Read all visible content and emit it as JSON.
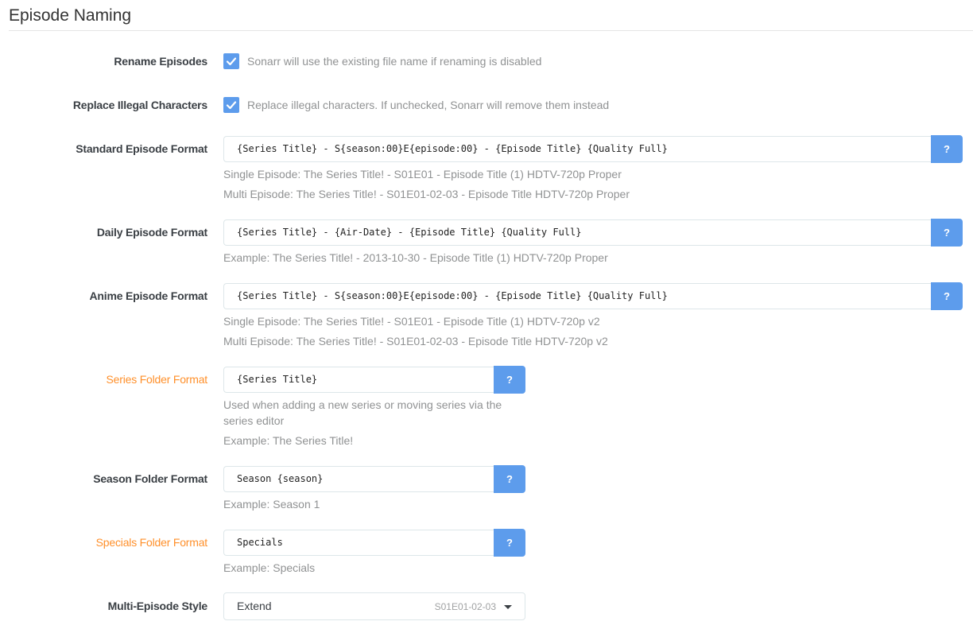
{
  "section": {
    "title": "Episode Naming"
  },
  "rename_episodes": {
    "label": "Rename Episodes",
    "checked": true,
    "help": "Sonarr will use the existing file name if renaming is disabled"
  },
  "replace_illegal": {
    "label": "Replace Illegal Characters",
    "checked": true,
    "help": "Replace illegal characters. If unchecked, Sonarr will remove them instead"
  },
  "standard_format": {
    "label": "Standard Episode Format",
    "value": "{Series Title} - S{season:00}E{episode:00} - {Episode Title} {Quality Full}",
    "help_button": "?",
    "single_example": "Single Episode: The Series Title! - S01E01 - Episode Title (1) HDTV-720p Proper",
    "multi_example": "Multi Episode: The Series Title! - S01E01-02-03 - Episode Title HDTV-720p Proper"
  },
  "daily_format": {
    "label": "Daily Episode Format",
    "value": "{Series Title} - {Air-Date} - {Episode Title} {Quality Full}",
    "help_button": "?",
    "example": "Example: The Series Title! - 2013-10-30 - Episode Title (1) HDTV-720p Proper"
  },
  "anime_format": {
    "label": "Anime Episode Format",
    "value": "{Series Title} - S{season:00}E{episode:00} - {Episode Title} {Quality Full}",
    "help_button": "?",
    "single_example": "Single Episode: The Series Title! - S01E01 - Episode Title (1) HDTV-720p v2",
    "multi_example": "Multi Episode: The Series Title! - S01E01-02-03 - Episode Title HDTV-720p v2"
  },
  "series_folder": {
    "label": "Series Folder Format",
    "value": "{Series Title}",
    "help_button": "?",
    "help_line1": "Used when adding a new series or moving series via the",
    "help_line2": "series editor",
    "example": "Example: The Series Title!"
  },
  "season_folder": {
    "label": "Season Folder Format",
    "value": "Season {season}",
    "help_button": "?",
    "example": "Example: Season 1"
  },
  "specials_folder": {
    "label": "Specials Folder Format",
    "value": "Specials",
    "help_button": "?",
    "example": "Example: Specials"
  },
  "multi_episode_style": {
    "label": "Multi-Episode Style",
    "selected": "Extend",
    "selected_hint": "S01E01-02-03"
  },
  "colors": {
    "accent": "#5d9cec",
    "warning_label": "#ff902b",
    "help_text": "#909293"
  }
}
